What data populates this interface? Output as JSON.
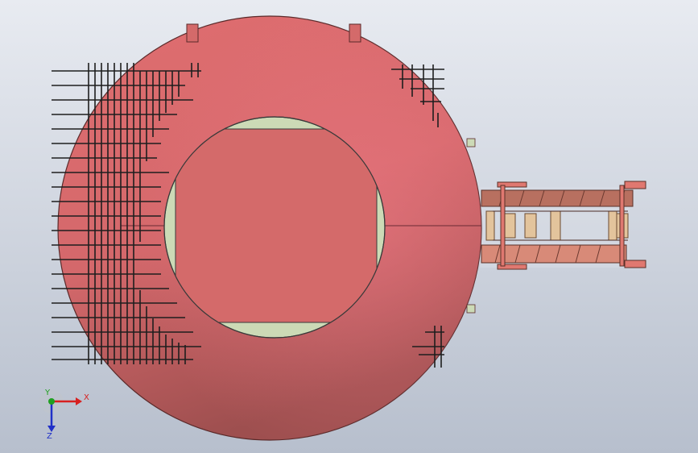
{
  "viewport": {
    "background_top": "#e8ebf1",
    "background_bottom": "#b7bfcd"
  },
  "model": {
    "ring_color": "#d9696b",
    "ring_shade": "#a65050",
    "square_color": "#d46a6a",
    "inner_frame_color": "#ccdab6",
    "rebar_color": "#1e1e1e",
    "conveyor_belt_color": "#b87060",
    "roller_color": "#e3c49c"
  },
  "triad": {
    "x_label": "X",
    "y_label": "Y",
    "z_label": "Z",
    "x_color": "#d72020",
    "y_color": "#20a020",
    "z_color": "#2030c8"
  }
}
